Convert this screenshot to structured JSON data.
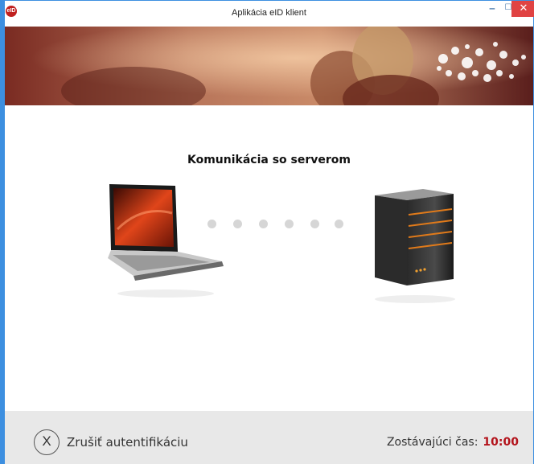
{
  "window": {
    "title": "Aplikácia eID klient",
    "app_icon_text": "eID",
    "minimize_glyph": "‒",
    "maximize_glyph": "☐",
    "close_glyph": "✕"
  },
  "main": {
    "heading": "Komunikácia so serverom",
    "progress_dots": 6
  },
  "footer": {
    "cancel_icon": "X",
    "cancel_label": "Zrušiť autentifikáciu",
    "timer_label": "Zostávajúci čas:",
    "timer_value": "10:00"
  },
  "colors": {
    "accent_border": "#3d8fe0",
    "timer_value": "#b3131b",
    "close_button": "#e04343"
  }
}
